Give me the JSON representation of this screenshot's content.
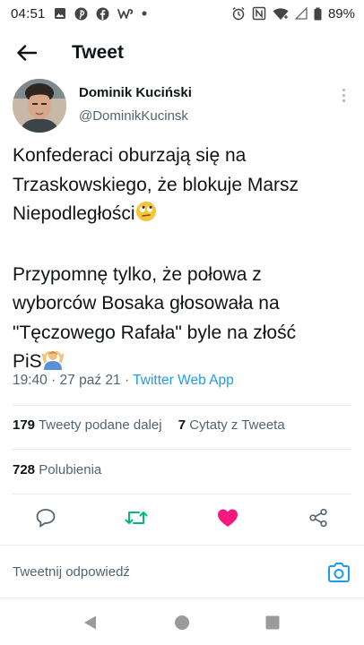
{
  "status_bar": {
    "time": "04:51",
    "battery": "89%",
    "left_icons": [
      "gallery-icon",
      "pinterest-icon",
      "facebook-icon",
      "w-app-icon",
      "dot-icon"
    ],
    "right_icons": [
      "alarm-icon",
      "nfc-icon",
      "wifi-icon",
      "signal-icon",
      "battery-icon"
    ]
  },
  "app_bar": {
    "title": "Tweet"
  },
  "author": {
    "name": "Dominik Kuciński",
    "handle": "@DominikKucinsk"
  },
  "tweet": {
    "paragraph1_lines": [
      "Konfederaci oburzają się na",
      "Trzaskowskiego, że blokuje Marsz",
      "Niepodległości"
    ],
    "paragraph2_lines": [
      "Przypomnę tylko, że połowa z",
      "wyborców Bosaka głosowała na",
      "\"Tęczowego Rafała\" byle na złość",
      "PiS"
    ],
    "emoji1": "face-with-rolling-eyes",
    "emoji2": "man-gesturing-ok"
  },
  "meta": {
    "time_date": "19:40 · 27 paź 21 · ",
    "source": "Twitter Web App"
  },
  "stats": {
    "retweets_count": "179",
    "retweets_label": "Tweety podane dalej",
    "quotes_count": "7",
    "quotes_label": "Cytaty z Tweeta",
    "likes_count": "728",
    "likes_label": "Polubienia"
  },
  "colors": {
    "accent": "#1d9bf0",
    "retweet_green": "#00ba7c",
    "like_pink": "#f91880",
    "muted": "#536471"
  },
  "reply": {
    "placeholder": "Tweetnij odpowiedź"
  }
}
